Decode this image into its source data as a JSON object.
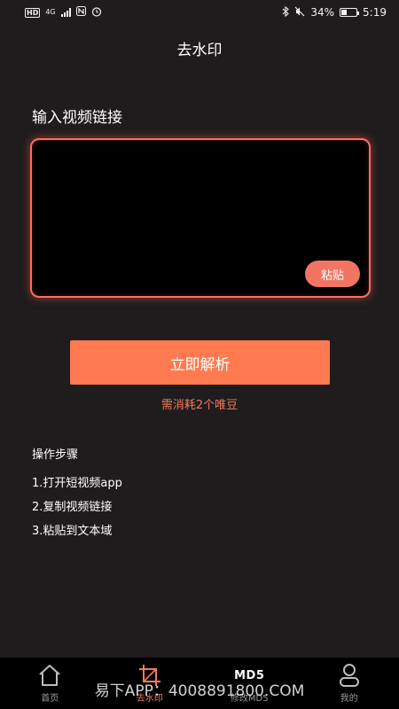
{
  "status_bar": {
    "hd_badge": "HD",
    "network": "4G",
    "battery_percent": "34%",
    "battery_level": 0.34,
    "time": "5:19",
    "icons": [
      "signal-icon",
      "nfc-icon",
      "alarm-icon",
      "bluetooth-icon",
      "mute-icon",
      "battery-icon"
    ]
  },
  "header": {
    "title": "去水印"
  },
  "main": {
    "input_label": "输入视频链接",
    "textarea": {
      "value": "",
      "placeholder": ""
    },
    "paste_label": "粘贴",
    "parse_label": "立即解析",
    "cost_note": "需消耗2个唯豆",
    "steps_title": "操作步骤",
    "steps": [
      "1.打开短视频app",
      "2.复制视频链接",
      "3.粘贴到文本域"
    ]
  },
  "tabs": [
    {
      "label": "首页",
      "icon": "home-icon",
      "active": false
    },
    {
      "label": "去水印",
      "icon": "crop-icon",
      "active": true
    },
    {
      "label": "修改MD5",
      "icon_text": "MD5",
      "active": false
    },
    {
      "label": "我的",
      "icon": "profile-icon",
      "active": false
    }
  ],
  "watermark": "易下APP：4008891800.COM",
  "colors": {
    "background": "#1f1c1d",
    "accent": "#ff7a50",
    "glow_border": "#ff6e61",
    "tab_bar": "#000000"
  }
}
